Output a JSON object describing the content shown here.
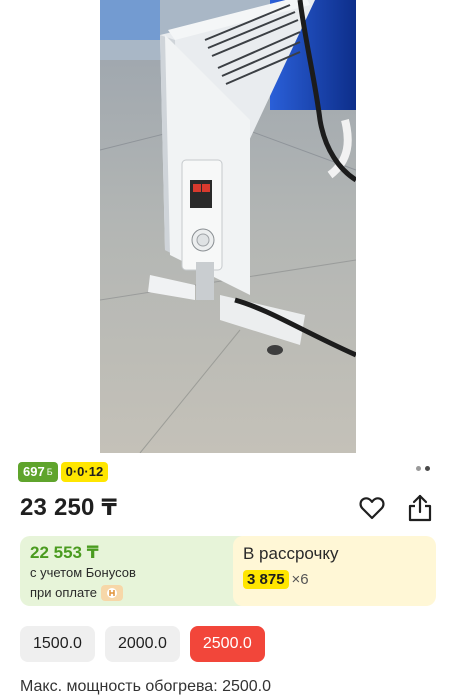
{
  "gallery": {
    "image_subject": "heater-photo",
    "dots_total": 2,
    "dots_active": 2
  },
  "badges": {
    "bonus_value": "697",
    "bonus_suffix": "Б",
    "installment": "0·0·12"
  },
  "price": {
    "amount": "23 250",
    "currency": "₸"
  },
  "actions": {
    "favorite_icon": "heart-icon",
    "share_icon": "share-icon"
  },
  "bonus_card": {
    "price": "22 553 ₸",
    "line1": "с учетом Бонусов",
    "line2": "при оплате"
  },
  "installment_card": {
    "title": "В рассрочку",
    "amount": "3 875",
    "multiplier": "×6"
  },
  "options": [
    {
      "label": "1500.0",
      "selected": false
    },
    {
      "label": "2000.0",
      "selected": false
    },
    {
      "label": "2500.0",
      "selected": true
    }
  ],
  "spec": {
    "text": "Макс. мощность обогрева: 2500.0"
  },
  "colors": {
    "accent": "#f2463a",
    "bonus_green": "#5fa42c",
    "installment_yellow": "#ffe600"
  }
}
